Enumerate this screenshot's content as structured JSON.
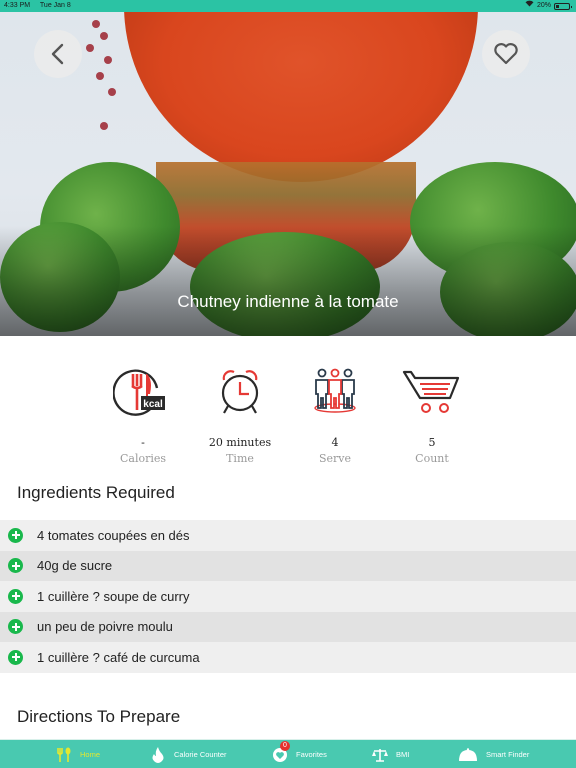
{
  "status_bar": {
    "time": "4:33 PM",
    "date": "Tue Jan 8",
    "wifi_icon": "wifi-icon",
    "battery": "20%"
  },
  "hero": {
    "title": "Chutney indienne à la tomate",
    "back_icon": "chevron-left-icon",
    "favorite_icon": "heart-outline-icon"
  },
  "stats": [
    {
      "icon": "kcal-fork-knife-icon",
      "value": "-",
      "label": "Calories"
    },
    {
      "icon": "alarm-clock-icon",
      "value": "20 minutes",
      "label": "Time"
    },
    {
      "icon": "people-group-icon",
      "value": "4",
      "label": "Serve"
    },
    {
      "icon": "shopping-cart-icon",
      "value": "5",
      "label": "Count"
    }
  ],
  "ingredients": {
    "title": "Ingredients Required",
    "items": [
      "4 tomates coupées en dés",
      "40g de sucre",
      "1 cuillère ? soupe de curry",
      "un peu de poivre moulu",
      "1 cuillère ? café de curcuma"
    ]
  },
  "directions": {
    "title": "Directions To Prepare"
  },
  "tab_bar": {
    "tabs": [
      {
        "label": "Home",
        "icon": "fork-spoon-icon",
        "active": true
      },
      {
        "label": "Calorie Counter",
        "icon": "flame-icon",
        "active": false
      },
      {
        "label": "Favorites",
        "icon": "heart-icon",
        "active": false,
        "badge": "0"
      },
      {
        "label": "BMI",
        "icon": "scale-icon",
        "active": false
      },
      {
        "label": "Smart Finder",
        "icon": "cloche-icon",
        "active": false
      }
    ]
  },
  "colors": {
    "accent": "#2bc3a4",
    "tab_bar": "#49c9b0",
    "active_tab": "#e3e830",
    "icon_red": "#e53935",
    "plus_green": "#19b84c",
    "badge_red": "#e5322d"
  }
}
